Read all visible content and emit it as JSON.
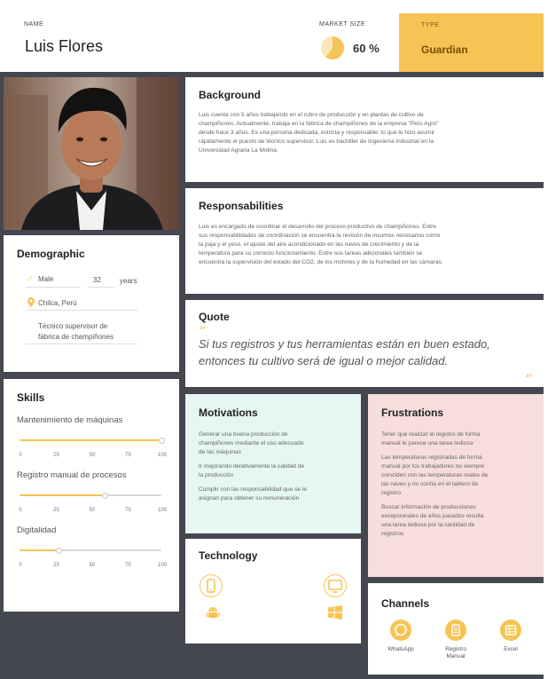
{
  "header": {
    "name_label": "NAME",
    "name": "Luis Flores",
    "market_label": "MARKET SIZE",
    "market_value": "60 %",
    "market_fraction": 0.6,
    "type_label": "TYPE",
    "type_value": "Guardian"
  },
  "background": {
    "title": "Background",
    "lines": [
      "Luis cuenta con 5 años trabajando en el rubro de producción y en plantas de cultivo de",
      "champiñones. Actualmente, trabaja en la fábrica de champiñones de la empresa \"Perú Agro\"",
      "desde hace 3 años. Es una persona dedicada, estricta y responsable; lo que le hizo asumir",
      "rápidamente el puesto de técnico supervisor. Luis es bachiller de Ingeniería Industrial en la",
      "Universidad Agraria La Molina."
    ]
  },
  "responsabilities": {
    "title": "Responsabilities",
    "lines": [
      "Luis es encargado de coordinar el desarrollo del proceso productivo de champiñones. Entre",
      "sus responsabilidades de coordinación se encuentra la revisión de insumos necesarios como",
      "la paja y el yeso, el ajuste del aire acondicionado en las naves de crecimiento y de la",
      "temperatura para su correcto funcionamiento. Entre sus tareas adicionales también se",
      "encuentra la supervisión del estado del CO2, de los motores y de la humedad en las cámaras."
    ]
  },
  "quote": {
    "title": "Quote",
    "line1": "Si tus registros y tus herramientas están en buen estado,",
    "line2": "entonces tu cultivo será de igual o mejor calidad.",
    "open_mark": "“",
    "close_mark": "”"
  },
  "demographic": {
    "title": "Demographic",
    "gender": "Male",
    "age": "32",
    "age_unit": "years",
    "location": "Chilca, Perú",
    "job_line1": "Técnico supervisor de",
    "job_line2": "fábrica de champiñones"
  },
  "skills": {
    "title": "Skills",
    "ticks": [
      "0",
      "25",
      "50",
      "75",
      "100"
    ],
    "items": [
      {
        "label": "Mantenimiento de máquinas",
        "value": 100
      },
      {
        "label": "Registro manual de procesos",
        "value": 60
      },
      {
        "label": "Digitalidad",
        "value": 28
      }
    ]
  },
  "motivations": {
    "title": "Motivations",
    "p1": [
      "Generar una buena producción de",
      "champiñones mediante el uso adecuado",
      "de las máquinas"
    ],
    "p2": [
      "Ir mejorando iterativamente la calidad de",
      "la producción"
    ],
    "p3": [
      "Cumplir con las responsabilidad que se le",
      "asignan para obtener su remuneración"
    ]
  },
  "frustrations": {
    "title": "Frustrations",
    "p1": [
      "Tener que realizar el registro de forma",
      "manual le parece una tarea tediosa"
    ],
    "p2": [
      "Las temperaturas registradas de forma",
      "manual por los trabajadores no siempre",
      "coinciden con las temperaturas reales de",
      "las naves y no confía en el tablero de",
      "registro"
    ],
    "p3": [
      "Buscar información de producciones",
      "excepcionales de años pasados resulta",
      "una tarea tediosa por la cantidad de",
      "registros"
    ]
  },
  "technology": {
    "title": "Technology",
    "icons": [
      "smartphone-icon",
      "monitor-icon",
      "android-icon",
      "windows-icon"
    ]
  },
  "channels": {
    "title": "Channels",
    "items": [
      {
        "line1": "WhatsApp",
        "line2": "",
        "icon": "whatsapp-icon"
      },
      {
        "line1": "Registro",
        "line2": "Manual",
        "icon": "notebook-icon"
      },
      {
        "line1": "Excel",
        "line2": "",
        "icon": "spreadsheet-icon"
      }
    ]
  },
  "colors": {
    "accent": "#f6c454",
    "dark": "#44474f",
    "motivations_bg": "#e6f6f2",
    "frustrations_bg": "#f7dedc"
  }
}
